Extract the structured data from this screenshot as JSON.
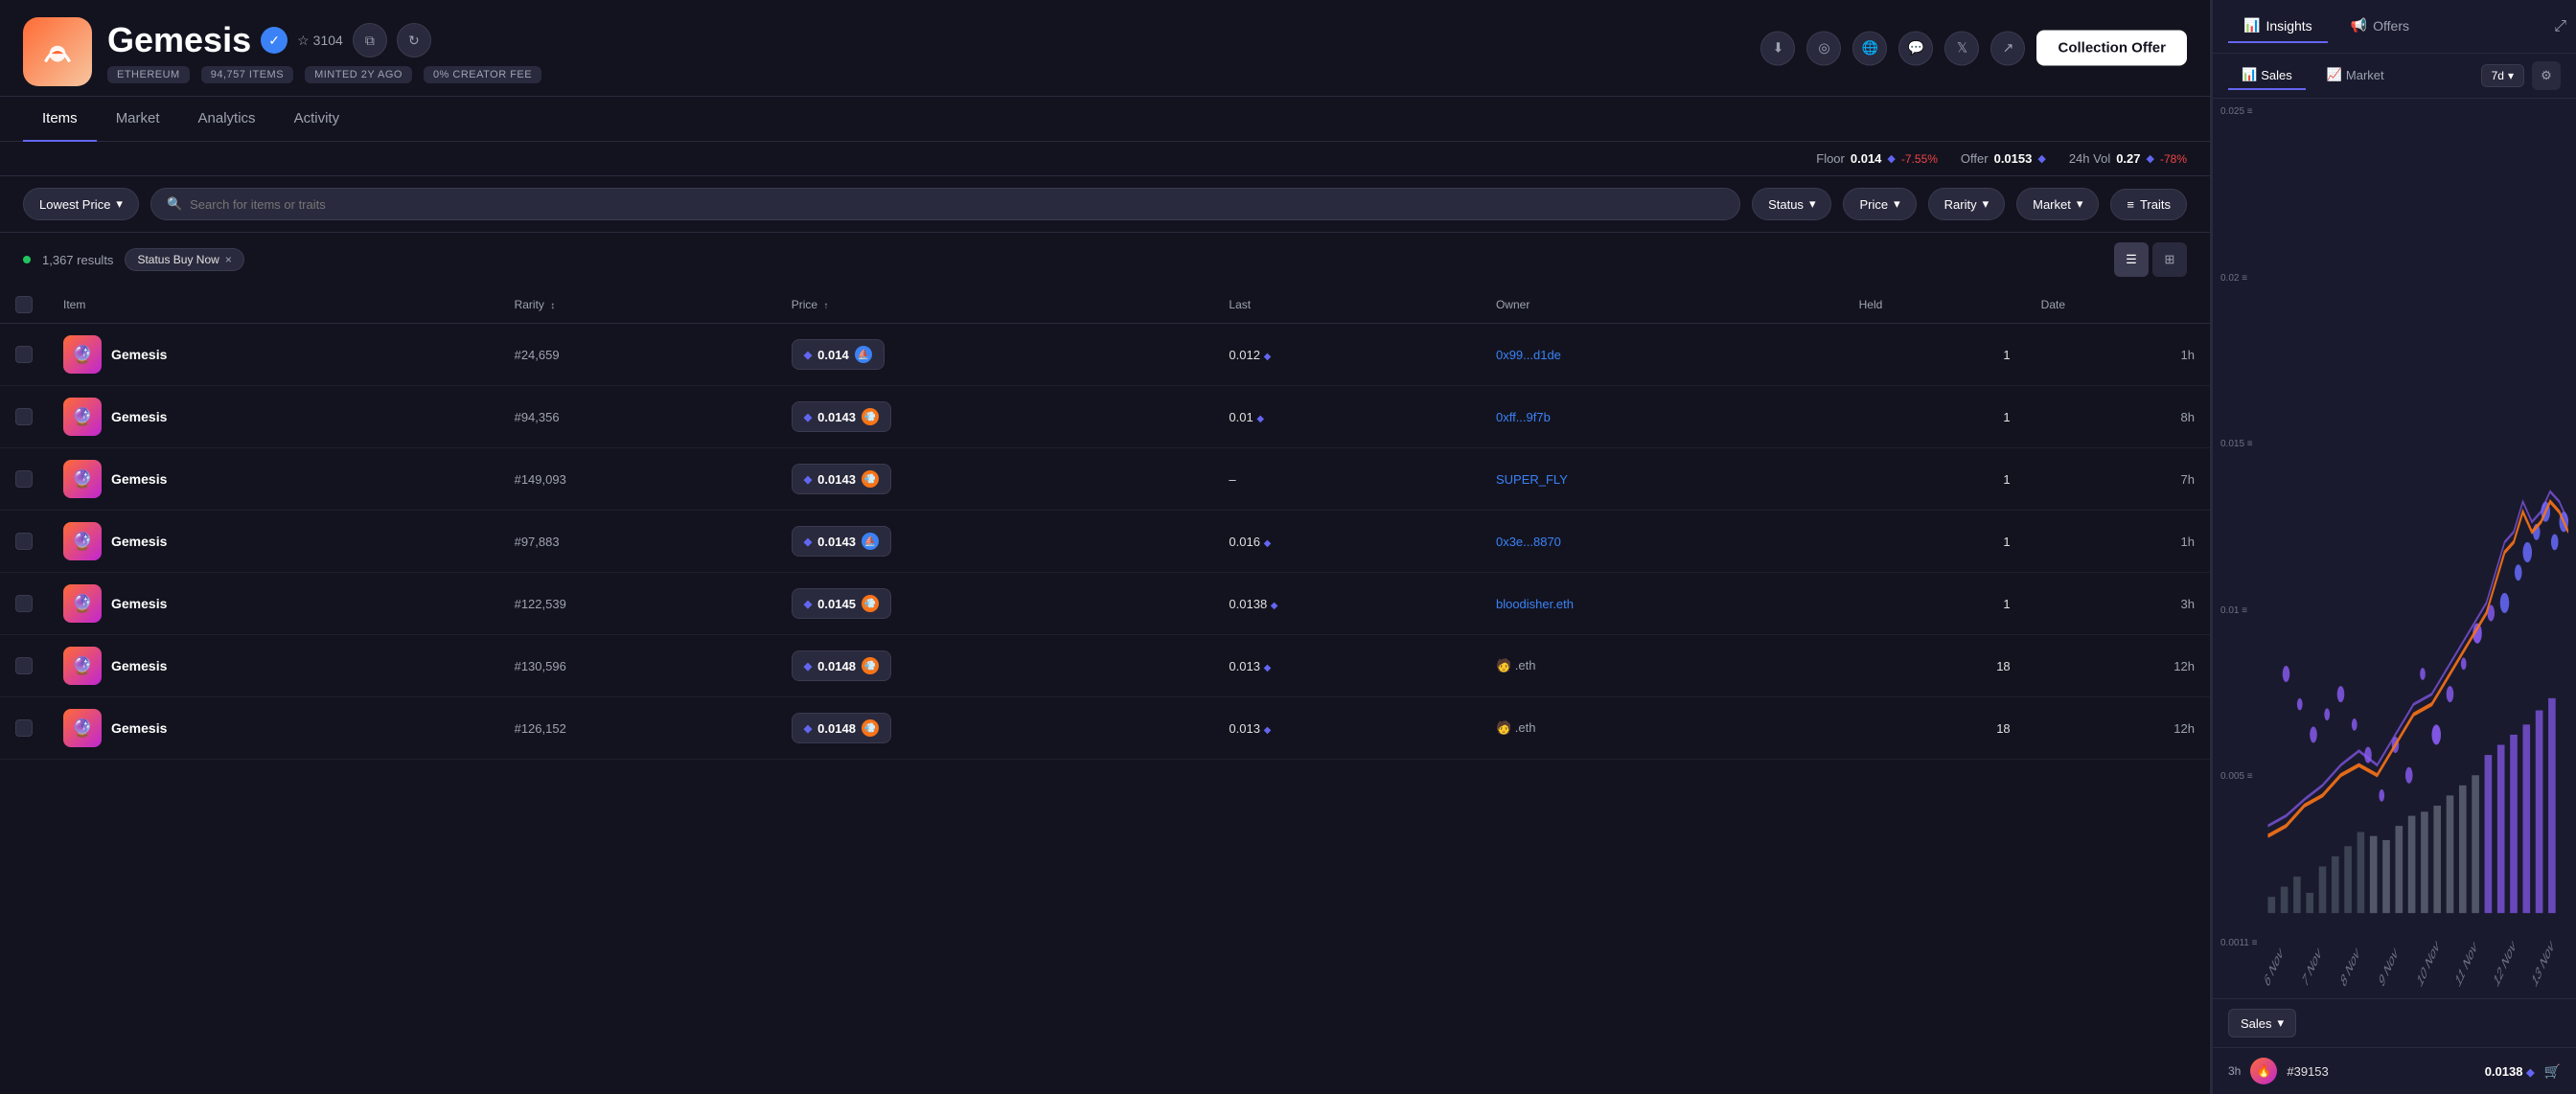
{
  "collection": {
    "name": "Gemesis",
    "verified": true,
    "stars": "3104",
    "chain": "ETHEREUM",
    "items": "94,757 ITEMS",
    "minted": "MINTED 2Y AGO",
    "creator_fee": "0% CREATOR FEE"
  },
  "header": {
    "collection_offer_label": "Collection Offer"
  },
  "nav": {
    "tabs": [
      "Items",
      "Market",
      "Analytics",
      "Activity"
    ],
    "active": "Items"
  },
  "stats": {
    "floor_label": "Floor",
    "floor_value": "0.014",
    "floor_change": "-7.55%",
    "offer_label": "Offer",
    "offer_value": "0.0153",
    "vol_label": "24h Vol",
    "vol_value": "0.27",
    "vol_change": "-78%"
  },
  "filters": {
    "sort_label": "Lowest Price",
    "search_placeholder": "Search for items or traits",
    "status_label": "Status",
    "price_label": "Price",
    "rarity_label": "Rarity",
    "market_label": "Market",
    "traits_label": "Traits"
  },
  "results": {
    "count": "1,367 results",
    "status_tag": "Status Buy Now",
    "tag_close": "×"
  },
  "table": {
    "headers": [
      "Item",
      "Rarity",
      "Price",
      "Last",
      "Owner",
      "Held",
      "Date"
    ],
    "rows": [
      {
        "name": "Gemesis",
        "rarity": "#24,659",
        "price": "0.014",
        "market": "os",
        "last": "0.012",
        "owner": "0x99...d1de",
        "owner_type": "link",
        "held": "1",
        "date": "1h"
      },
      {
        "name": "Gemesis",
        "rarity": "#94,356",
        "price": "0.0143",
        "market": "blur",
        "last": "0.01",
        "owner": "0xff...9f7b",
        "owner_type": "link",
        "held": "1",
        "date": "8h"
      },
      {
        "name": "Gemesis",
        "rarity": "#149,093",
        "price": "0.0143",
        "market": "blur",
        "last": "–",
        "owner": "SUPER_FLY",
        "owner_type": "link",
        "held": "1",
        "date": "7h"
      },
      {
        "name": "Gemesis",
        "rarity": "#97,883",
        "price": "0.0143",
        "market": "os",
        "last": "0.016",
        "owner": "0x3e...8870",
        "owner_type": "link",
        "held": "1",
        "date": "1h"
      },
      {
        "name": "Gemesis",
        "rarity": "#122,539",
        "price": "0.0145",
        "market": "blur",
        "last": "0.0138",
        "owner": "bloodisher.eth",
        "owner_type": "link",
        "held": "1",
        "date": "3h"
      },
      {
        "name": "Gemesis",
        "rarity": "#130,596",
        "price": "0.0148",
        "market": "blur",
        "last": "0.013",
        "owner": "🧑 .eth",
        "owner_type": "emoji",
        "held": "18",
        "date": "12h"
      },
      {
        "name": "Gemesis",
        "rarity": "#126,152",
        "price": "0.0148",
        "market": "blur",
        "last": "0.013",
        "owner": "🧑 .eth",
        "owner_type": "emoji",
        "held": "18",
        "date": "12h"
      }
    ]
  },
  "right_panel": {
    "tabs": [
      "Insights",
      "Offers"
    ],
    "active": "Insights",
    "chart_tabs": [
      "Sales",
      "Market"
    ],
    "active_chart": "Sales",
    "time_period": "7d",
    "y_labels": [
      "0.025",
      "0.02",
      "0.015",
      "0.01",
      "0.005",
      "0.0011"
    ],
    "x_labels": [
      "6 Nov",
      "7 Nov",
      "8 Nov",
      "9 Nov",
      "10 Nov",
      "11 Nov",
      "12 Nov",
      "13 Nov"
    ],
    "sales_dropdown": "Sales",
    "last_sale": {
      "time": "3h",
      "id": "#39153",
      "price": "0.0138"
    }
  }
}
